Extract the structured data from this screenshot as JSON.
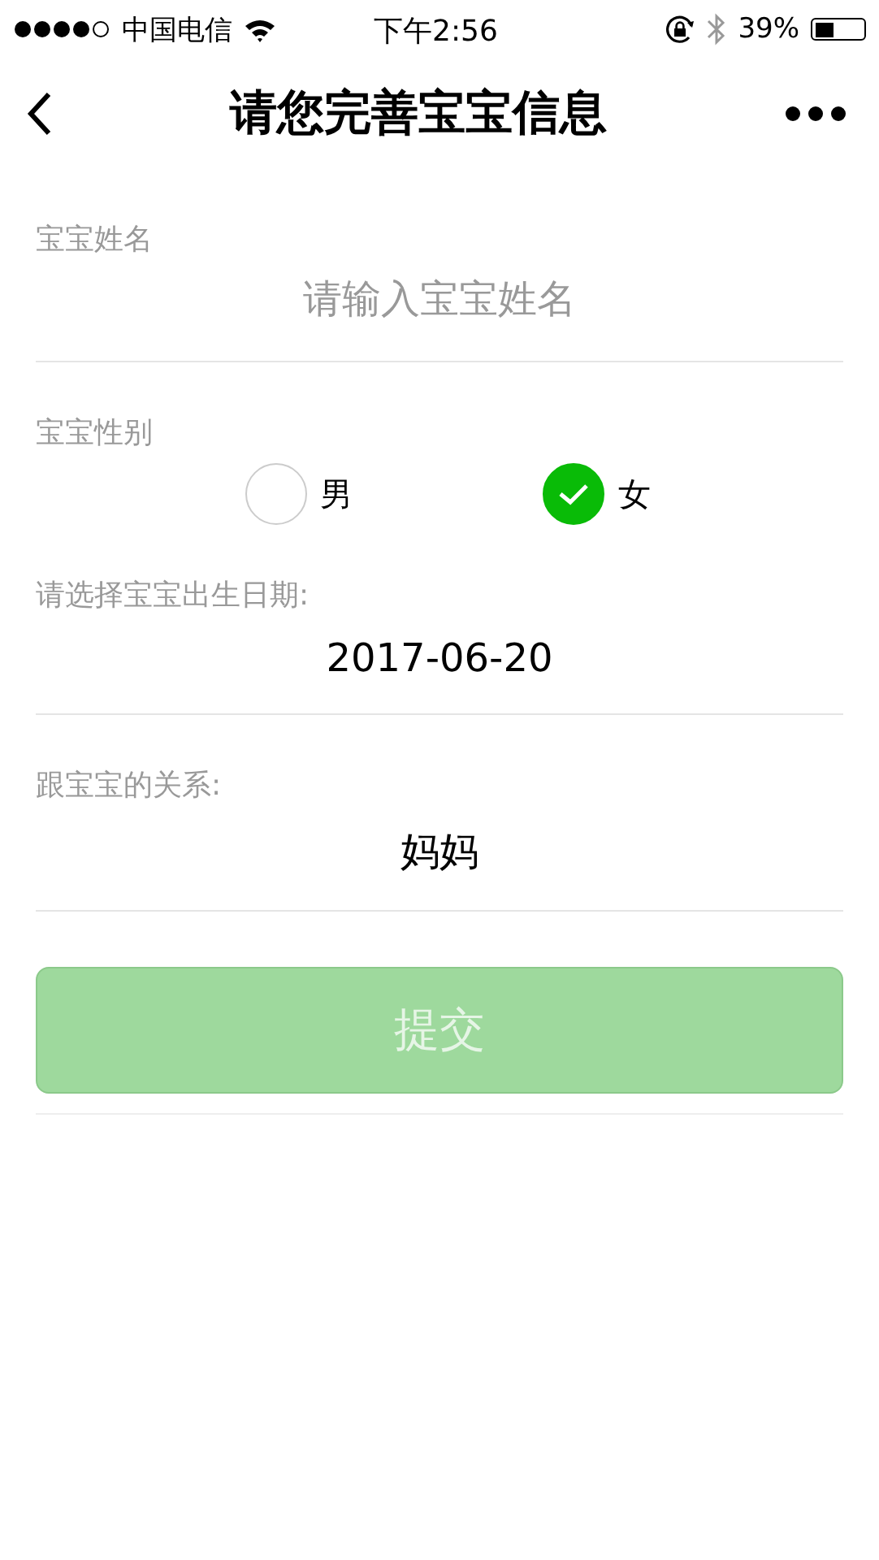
{
  "status_bar": {
    "carrier": "中国电信",
    "time": "下午2:56",
    "battery_text": "39%"
  },
  "nav": {
    "title": "请您完善宝宝信息"
  },
  "name_field": {
    "label": "宝宝姓名",
    "placeholder": "请输入宝宝姓名"
  },
  "gender": {
    "label": "宝宝性别",
    "options": [
      {
        "label": "男",
        "selected": false
      },
      {
        "label": "女",
        "selected": true
      }
    ]
  },
  "birth_date": {
    "label": "请选择宝宝出生日期:",
    "value": "2017-06-20"
  },
  "relation": {
    "label": "跟宝宝的关系:",
    "value": "妈妈"
  },
  "submit": {
    "label": "提交",
    "disabled": true
  }
}
